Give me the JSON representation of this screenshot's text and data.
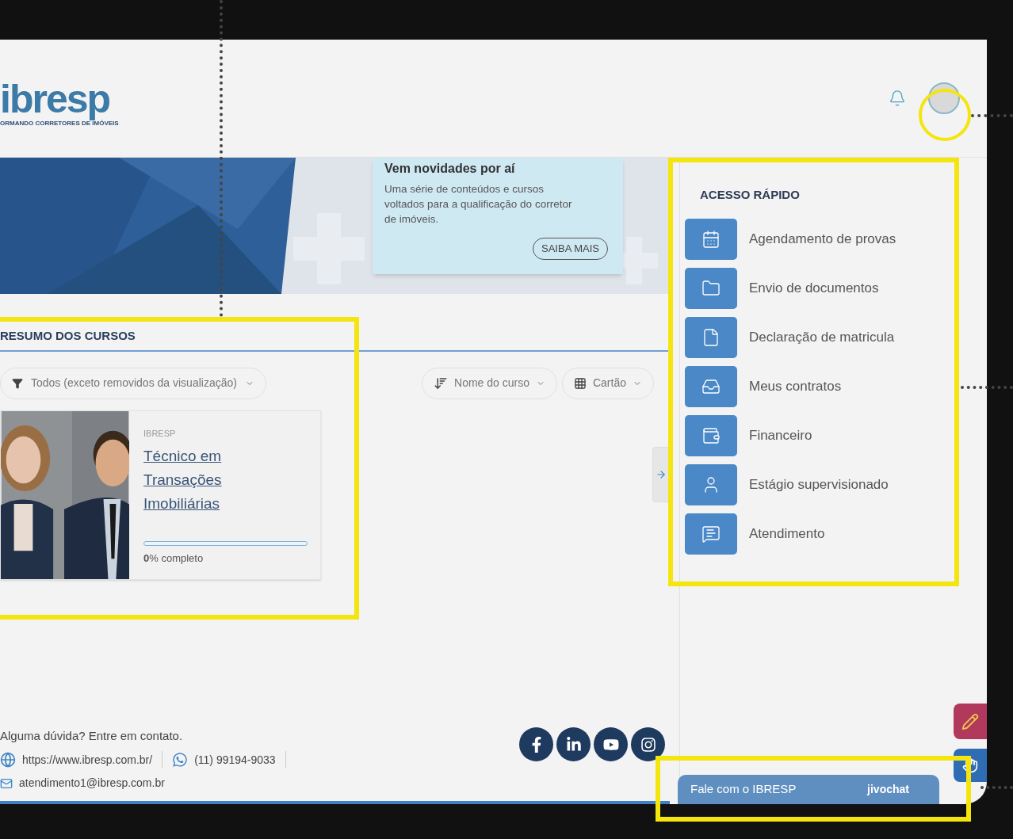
{
  "header": {
    "logo": {
      "wordmark": "ibresp",
      "tagline": "ORMANDO CORRETORES DE IMÓVEIS"
    }
  },
  "banner": {
    "title": "Vem novidades por aí",
    "text": "Uma série de conteúdos e cursos voltados para a qualificação do corretor de imóveis.",
    "button": "SAIBA MAIS"
  },
  "courses": {
    "title": "RESUMO DOS CURSOS",
    "filter": "Todos (exceto removidos da visualização)",
    "sort": "Nome do curso",
    "view": "Cartão",
    "cards": [
      {
        "category": "IBRESP",
        "name": "Técnico em Transações Imobiliárias",
        "level": 0,
        "progress": "**0**% completo"
      }
    ]
  },
  "quick_access": {
    "title": "ACESSO RÁPIDO",
    "items": [
      {
        "kind": "calendar",
        "label": "Agendamento de provas"
      },
      {
        "kind": "folder",
        "label": "Envio de documentos"
      },
      {
        "kind": "file",
        "label": "Declaração de matricula"
      },
      {
        "kind": "inbox",
        "label": "Meus contratos"
      },
      {
        "kind": "wallet",
        "label": "Financeiro"
      },
      {
        "kind": "user",
        "label": "Estágio supervisionado"
      },
      {
        "kind": "message",
        "label": "Atendimento"
      }
    ]
  },
  "footer": {
    "prompt": "Alguma dúvida? Entre em contato.",
    "website": "https://www.ibresp.com.br/",
    "phone": "(11) 99194-9033",
    "email": "atendimento1@ibresp.com.br",
    "social": [
      {
        "kind": "facebook"
      },
      {
        "kind": "linkedin"
      },
      {
        "kind": "youtube"
      },
      {
        "kind": "instagram"
      }
    ]
  },
  "chat": {
    "label": "Fale com o IBRESP",
    "brand": "jivochat"
  }
}
